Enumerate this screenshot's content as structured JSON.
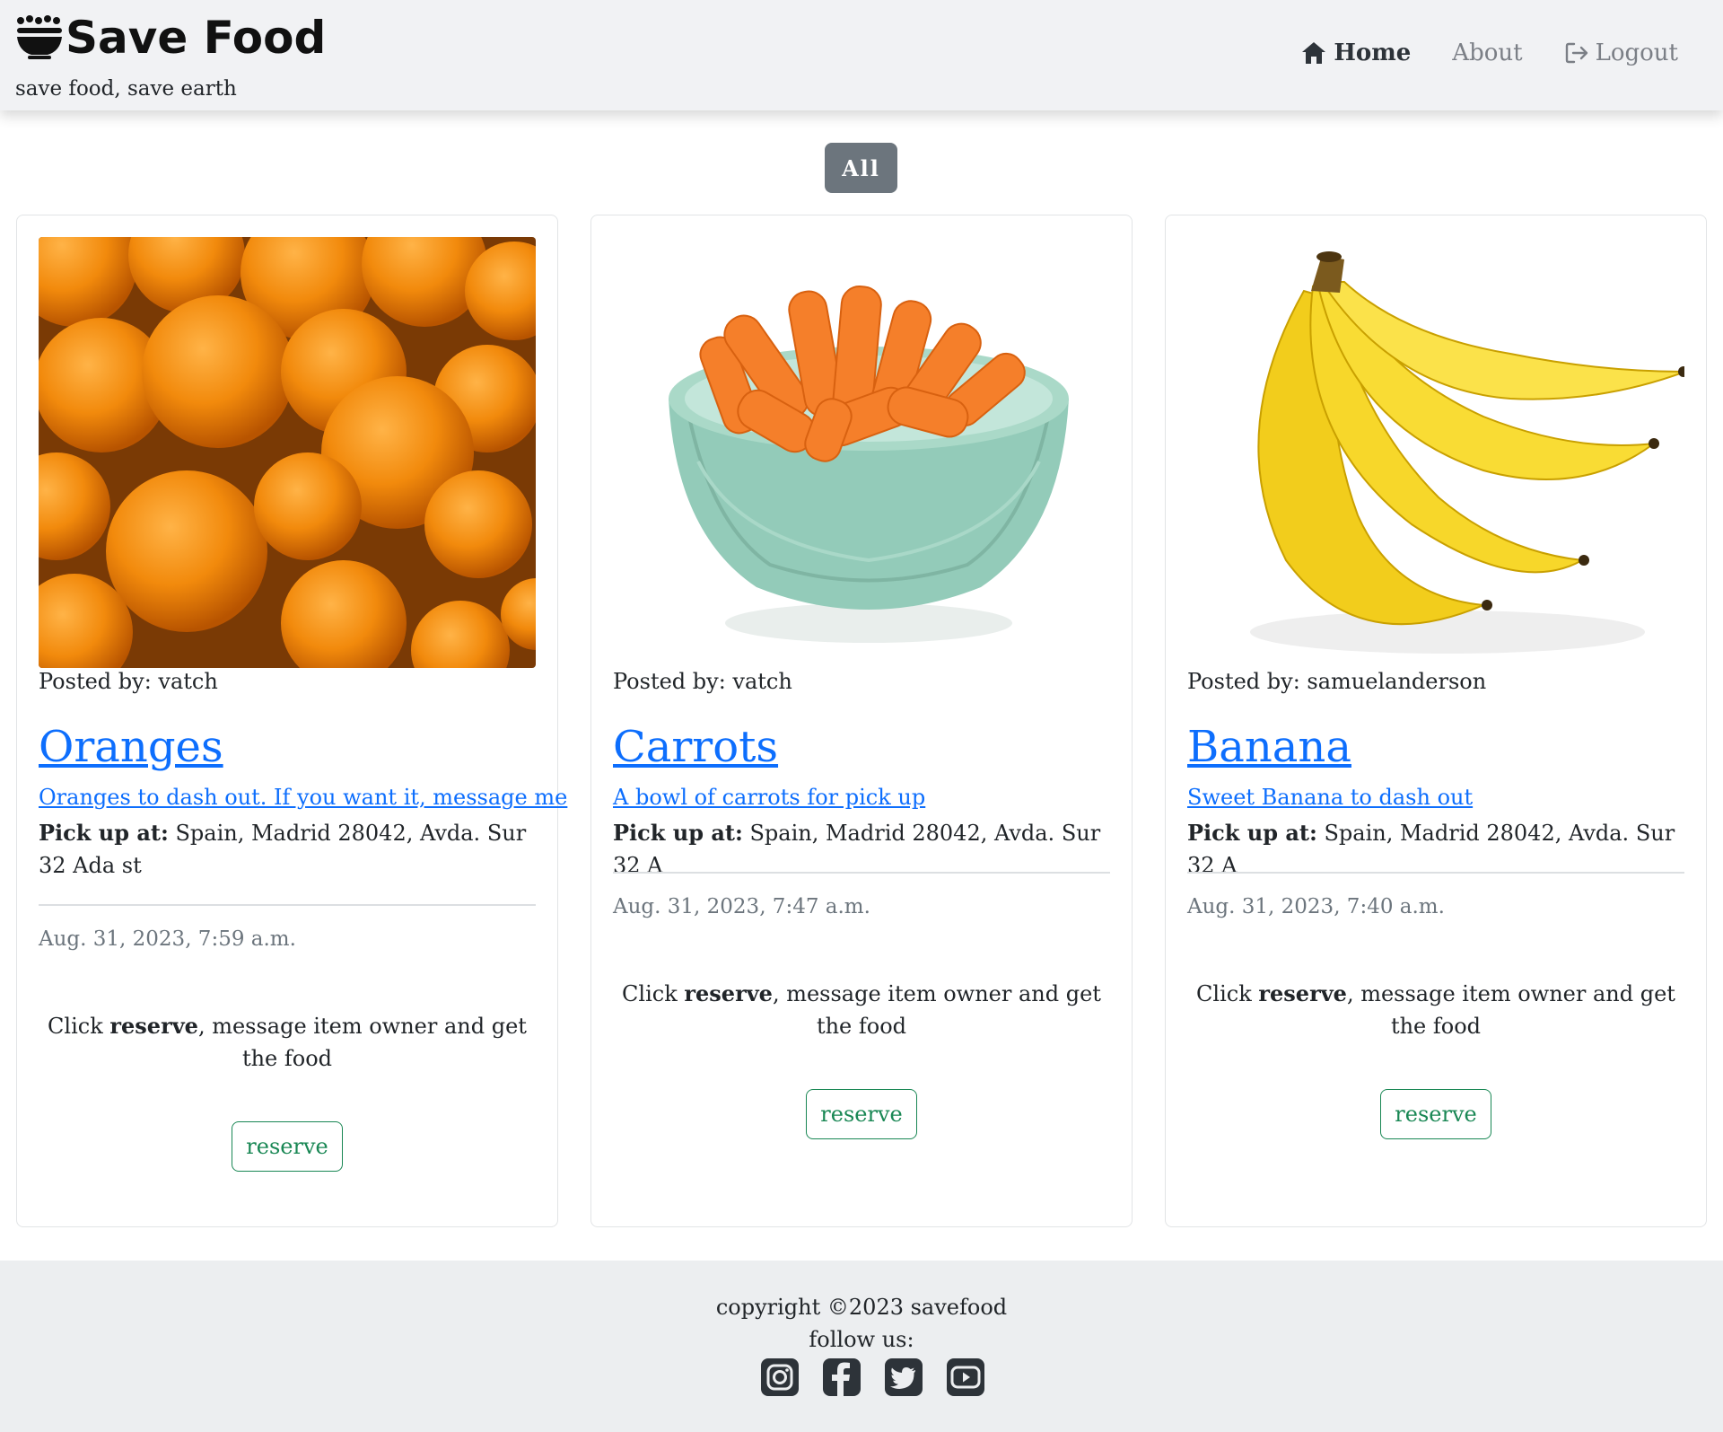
{
  "header": {
    "brand": "Save Food",
    "tagline": "save food, save earth",
    "nav": [
      {
        "label": "Home",
        "icon": "home-icon",
        "active": true
      },
      {
        "label": "About",
        "icon": "",
        "active": false
      },
      {
        "label": "Logout",
        "icon": "logout-icon",
        "active": false
      }
    ]
  },
  "filter": {
    "label": "All"
  },
  "cards": [
    {
      "image": "oranges-image",
      "posted_by": "Posted by: vatch",
      "title": "Oranges",
      "description": "Oranges to dash out. If you want it, message me",
      "pickup_label": "Pick up at:",
      "pickup_address": " Spain, Madrid 28042, Avda. Sur 32 Ada st",
      "date": "Aug. 31, 2023, 7:59 a.m.",
      "info_pre": "Click ",
      "info_bold": "reserve",
      "info_post": ", message item owner and get the food",
      "button": "reserve"
    },
    {
      "image": "carrots-image",
      "posted_by": "Posted by: vatch",
      "title": "Carrots",
      "description": "A bowl of carrots for pick up",
      "pickup_label": "Pick up at:",
      "pickup_address": " Spain, Madrid 28042, Avda. Sur 32 A",
      "date": "Aug. 31, 2023, 7:47 a.m.",
      "info_pre": "Click ",
      "info_bold": "reserve",
      "info_post": ", message item owner and get the food",
      "button": "reserve"
    },
    {
      "image": "banana-image",
      "posted_by": "Posted by: samuelanderson",
      "title": "Banana",
      "description": "Sweet Banana to dash out",
      "pickup_label": "Pick up at:",
      "pickup_address": " Spain, Madrid 28042, Avda. Sur 32 A",
      "date": "Aug. 31, 2023, 7:40 a.m.",
      "info_pre": "Click ",
      "info_bold": "reserve",
      "info_post": ", message item owner and get the food",
      "button": "reserve"
    }
  ],
  "footer": {
    "copyright": "copyright ©2023 savefood",
    "follow": "follow us:",
    "socials": [
      "instagram-icon",
      "facebook-icon",
      "twitter-icon",
      "youtube-icon"
    ]
  },
  "colors": {
    "link": "#0d6efd",
    "reserve": "#198754",
    "filter_bg": "#6c757d",
    "navbar_bg": "#f1f2f4",
    "footer_bg": "#eceef0"
  }
}
